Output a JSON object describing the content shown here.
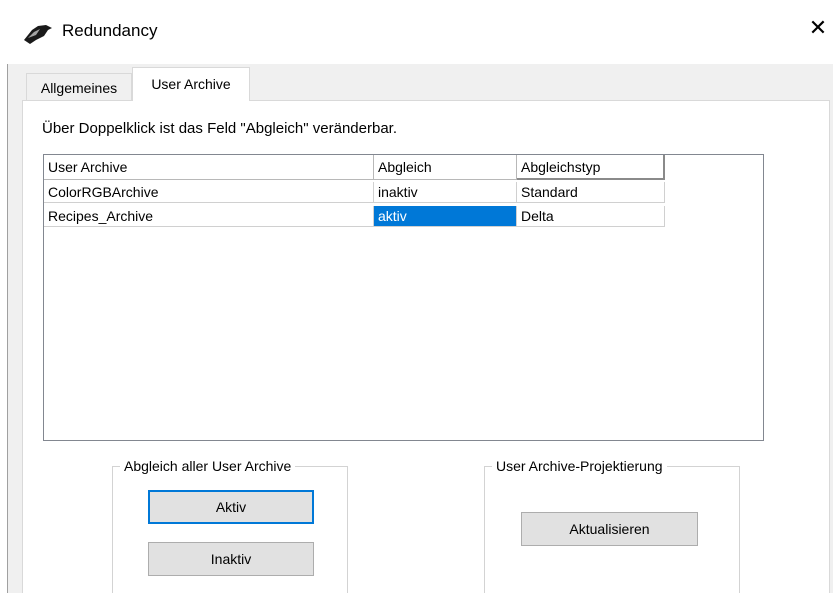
{
  "window": {
    "title": "Redundancy",
    "close_glyph": "✕"
  },
  "tabs": [
    {
      "label": "Allgemeines",
      "active": false
    },
    {
      "label": "User Archive",
      "active": true
    }
  ],
  "hint_text": "Über Doppelklick ist das Feld \"Abgleich\" veränderbar.",
  "table": {
    "columns": [
      "User Archive",
      "Abgleich",
      "Abgleichstyp"
    ],
    "rows": [
      [
        "ColorRGBArchive",
        "inaktiv",
        "Standard"
      ],
      [
        "Recipes_Archive",
        "aktiv",
        "Delta"
      ]
    ],
    "selected_cell": {
      "row": 1,
      "column": 1
    }
  },
  "group_sync": {
    "title": "Abgleich aller User Archive",
    "active_label": "Aktiv",
    "inactive_label": "Inaktiv"
  },
  "group_projecting": {
    "title": "User Archive-Projektierung",
    "update_label": "Aktualisieren"
  },
  "colors": {
    "selection": "#0078d7",
    "button_face": "#e1e1e1",
    "dialog_background": "#f0f0f0"
  }
}
